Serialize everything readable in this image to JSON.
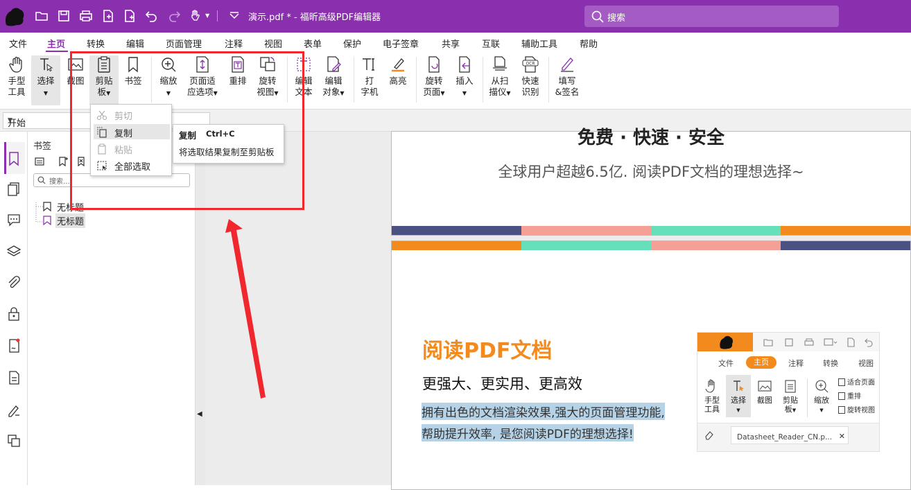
{
  "titlebar": {
    "doc_title": "演示.pdf * - 福昕高级PDF编辑器",
    "search_placeholder": "搜索",
    "bg": "#8a2fae"
  },
  "menu": [
    "文件",
    "主页",
    "转换",
    "编辑",
    "页面管理",
    "注释",
    "视图",
    "表单",
    "保护",
    "电子签章",
    "共享",
    "互联",
    "辅助工具",
    "帮助"
  ],
  "menu_active": "主页",
  "ribbon": {
    "hand_l1": "手型",
    "hand_l2": "工具",
    "select_l1": "选择",
    "snapshot": "截图",
    "clipboard_l1": "剪贴",
    "clipboard_l2": "板",
    "bookmark": "书签",
    "zoom": "缩放",
    "fit_l1": "页面适",
    "fit_l2": "应选项",
    "reflow": "重排",
    "rotate_l1": "旋转",
    "rotate_l2": "视图",
    "edit_text_l1": "编辑",
    "edit_text_l2": "文本",
    "edit_obj_l1": "编辑",
    "edit_obj_l2": "对象",
    "type_l1": "打",
    "type_l2": "字机",
    "highlight": "高亮",
    "rotate_page_l1": "旋转",
    "rotate_page_l2": "页面",
    "insert": "插入",
    "scan_l1": "从扫",
    "scan_l2": "描仪",
    "ocr_l1": "快速",
    "ocr_l2": "识别",
    "sign_l1": "填写",
    "sign_l2": "&签名"
  },
  "nav_tab": "开始",
  "clipboard_menu": {
    "cut": "剪切",
    "copy": "复制",
    "paste": "粘贴",
    "select_all": "全部选取"
  },
  "tooltip": {
    "title": "复制",
    "shortcut": "Ctrl+C",
    "desc": "将选取结果复制至剪贴板"
  },
  "panel": {
    "title": "书签",
    "search_placeholder": "搜索...",
    "bookmarks": [
      "无标题",
      "无标题"
    ]
  },
  "doc": {
    "top_heading": "免费 · 快速 · 安全",
    "top_sub": "全球用户超越6.5亿. 阅读PDF文档的理想选择~",
    "h1": "阅读PDF文档",
    "h2": "更强大、更实用、更高效",
    "p1": "拥有出色的文档渲染效果,强大的页面管理功能,",
    "p2": "帮助提升效率, 是您阅读PDF的理想选择!",
    "orange": "#f28a1e",
    "stripe_colors": [
      "#4b5282",
      "#f5a094",
      "#66e0bb",
      "#f28a1e"
    ]
  },
  "mini": {
    "tabs": [
      "文件",
      "主页",
      "注释",
      "转换",
      "视图"
    ],
    "hand_l1": "手型",
    "hand_l2": "工具",
    "select": "选择",
    "snapshot": "截图",
    "clip_l1": "剪贴",
    "clip_l2": "板",
    "zoom": "缩放",
    "fit": "适合页面",
    "reflow": "重排",
    "rotate": "旋转视图",
    "file_tab": "Datasheet_Reader_CN.p..."
  }
}
